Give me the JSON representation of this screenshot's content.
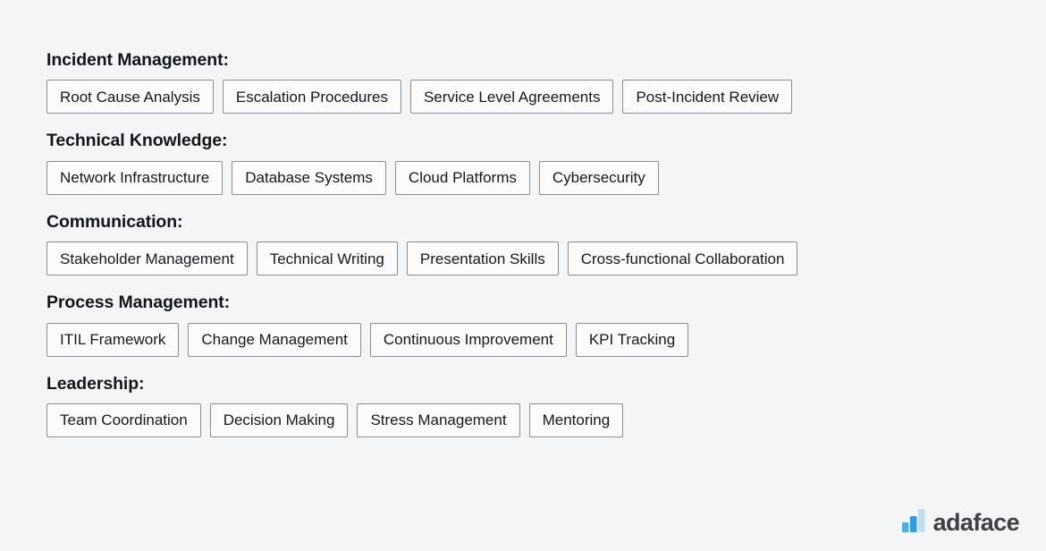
{
  "background_color": "#f4f5f6",
  "chip": {
    "border_color": "#8b8e93",
    "fill_color": "#fbfbfc",
    "text_color": "#15181c"
  },
  "sections": [
    {
      "heading": "Incident Management:",
      "chips": [
        "Root Cause Analysis",
        "Escalation Procedures",
        "Service Level Agreements",
        "Post-Incident Review"
      ]
    },
    {
      "heading": "Technical Knowledge:",
      "chips": [
        "Network Infrastructure",
        "Database Systems",
        "Cloud Platforms",
        "Cybersecurity"
      ]
    },
    {
      "heading": "Communication:",
      "chips": [
        "Stakeholder Management",
        "Technical Writing",
        "Presentation Skills",
        "Cross-functional Collaboration"
      ]
    },
    {
      "heading": "Process Management:",
      "chips": [
        "ITIL Framework",
        "Change Management",
        "Continuous Improvement",
        "KPI Tracking"
      ]
    },
    {
      "heading": "Leadership:",
      "chips": [
        "Team Coordination",
        "Decision Making",
        "Stress Management",
        "Mentoring"
      ]
    }
  ],
  "brand": {
    "name": "adaface",
    "logo_icon": "bar-chart-logo-icon",
    "bar_colors": [
      "#4aaff0",
      "#2f9bed",
      "#bcdff8"
    ],
    "word_color": "#3f4044"
  }
}
